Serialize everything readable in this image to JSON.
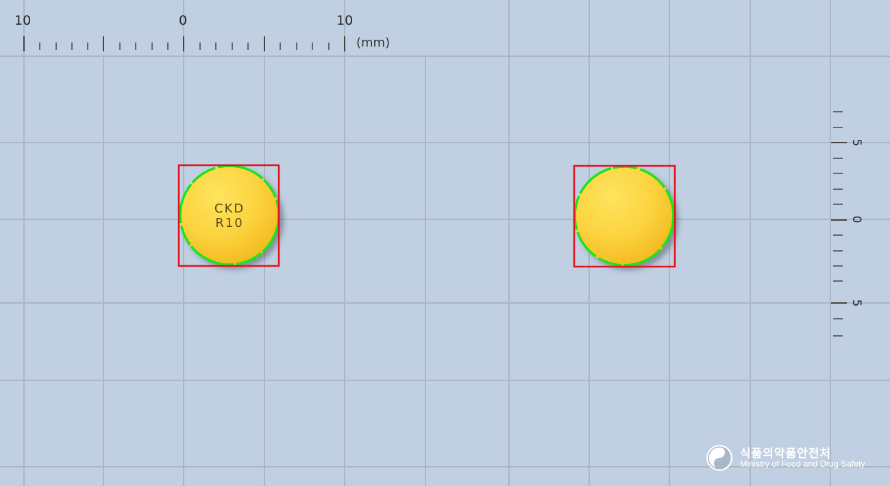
{
  "ruler": {
    "unit": "(mm)",
    "h_labels": [
      "10",
      "0",
      "10"
    ],
    "v_labels": [
      "5",
      "0",
      "5"
    ]
  },
  "pills": [
    {
      "imprint_line1": "CKD",
      "imprint_line2": "R10"
    },
    {
      "imprint_line1": "",
      "imprint_line2": ""
    }
  ],
  "logo": {
    "korean": "식품의약품안전처",
    "english": "Ministry of Food and Drug Safety"
  },
  "colors": {
    "background": "#c0cfe1",
    "grid": "#a8b6c6",
    "pill": "#fcd33f",
    "outline": "#19e519",
    "box": "#e0141e"
  }
}
